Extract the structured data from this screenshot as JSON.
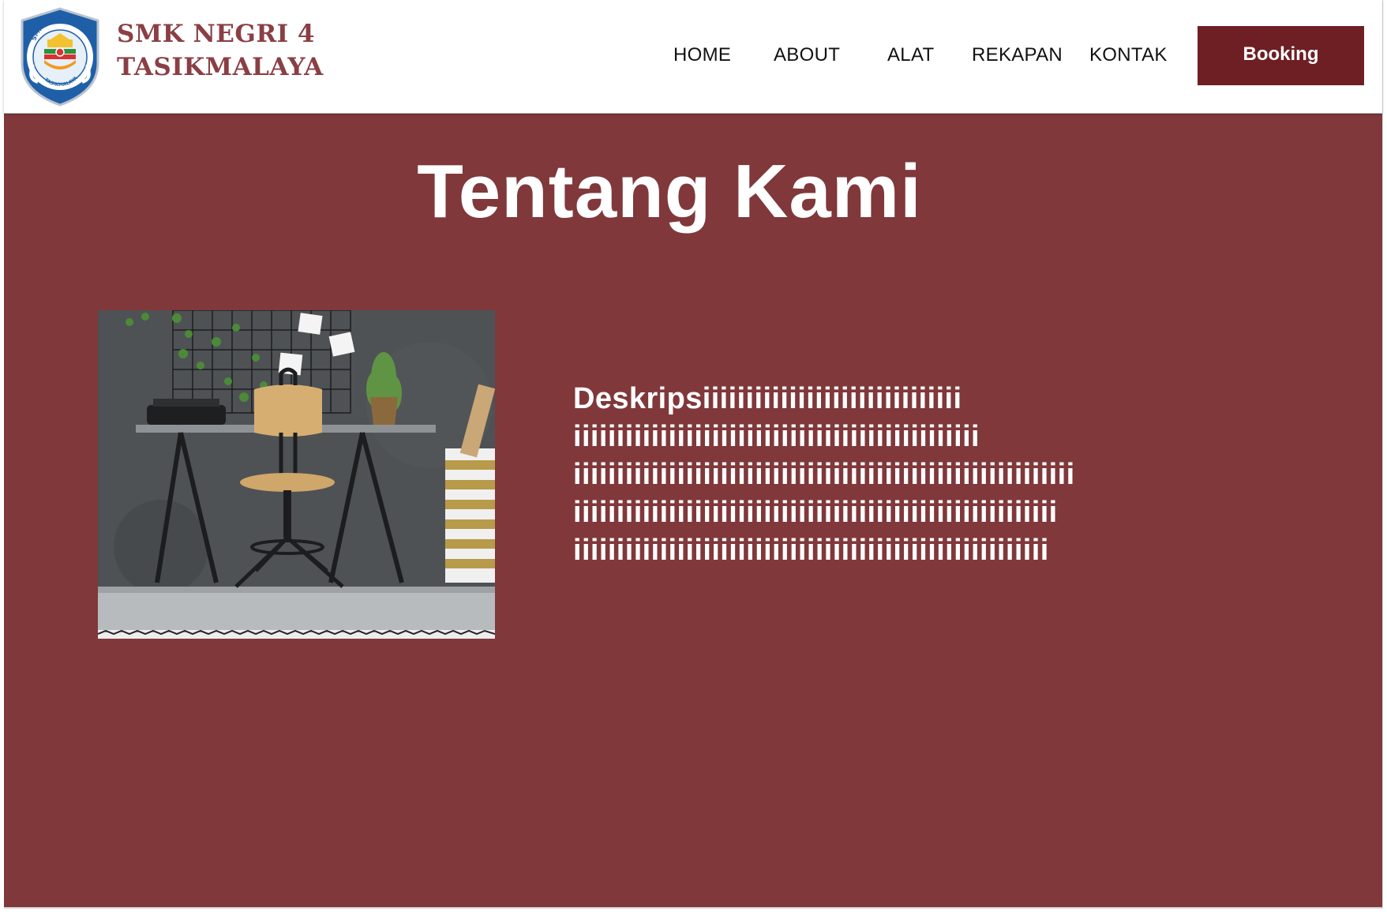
{
  "brand": {
    "line1": "SMK NEGRI 4",
    "line2": "TASIKMALAYA",
    "logo_text_top": "SMK NEGERI 4",
    "logo_text_bottom": "TASIKMALAYA",
    "color": "#8a3f44"
  },
  "nav": {
    "items": [
      {
        "label": "HOME"
      },
      {
        "label": "ABOUT"
      },
      {
        "label": "ALAT"
      },
      {
        "label": "REKAPAN"
      },
      {
        "label": "KONTAK"
      }
    ],
    "booking_label": "Booking",
    "booking_color": "#6e1f23"
  },
  "main": {
    "background": "#80383b",
    "title": "Tentang Kami",
    "photo_alt": "desk-with-chair-photo",
    "description_lines": [
      "Deskripsiiiiiiiiiiiiiiiiiiiiiiiiiiiiii",
      "iiiiiiiiiiiiiiiiiiiiiiiiiiiiiiiiiiiiiiiiiiiiiii",
      "iiiiiiiiiiiiiiiiiiiiiiiiiiiiiiiiiiiiiiiiiiiiiiiiiiiiiiiiii",
      "iiiiiiiiiiiiiiiiiiiiiiiiiiiiiiiiiiiiiiiiiiiiiiiiiiiiiiii",
      "iiiiiiiiiiiiiiiiiiiiiiiiiiiiiiiiiiiiiiiiiiiiiiiiiiiiiii"
    ]
  }
}
